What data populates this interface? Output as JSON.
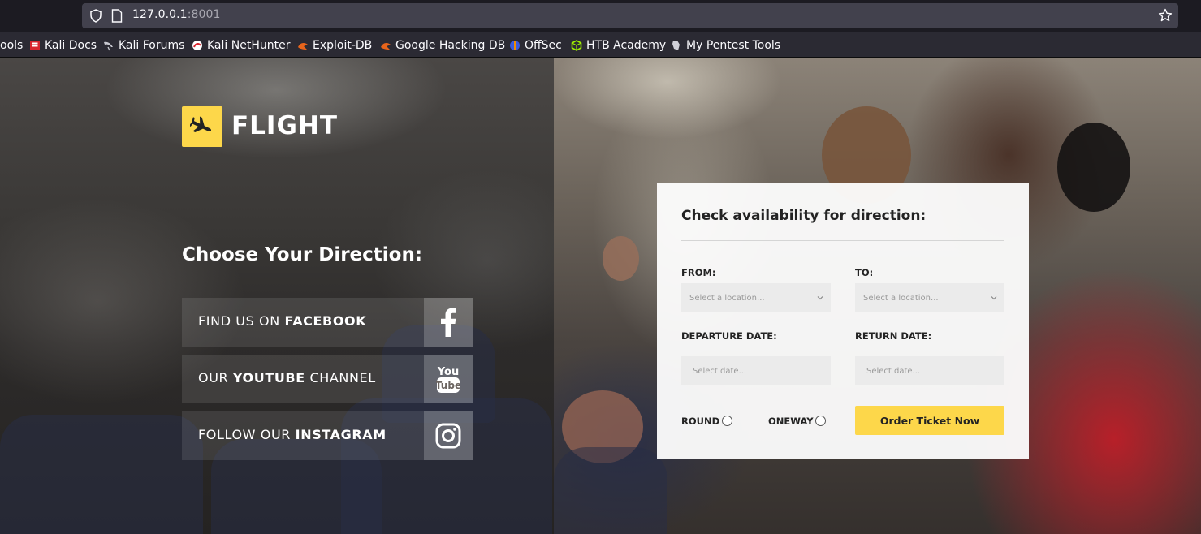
{
  "browser": {
    "url_host": "127.0.0.1",
    "url_port": ":8001",
    "bookmarks": [
      {
        "label": "ools",
        "icon": "none"
      },
      {
        "label": "Kali Docs",
        "icon": "kali-docs-icon"
      },
      {
        "label": "Kali Forums",
        "icon": "kali-dragon-icon"
      },
      {
        "label": "Kali NetHunter",
        "icon": "nethunter-icon"
      },
      {
        "label": "Exploit-DB",
        "icon": "exploit-db-icon"
      },
      {
        "label": "Google Hacking DB",
        "icon": "ghdb-icon"
      },
      {
        "label": "OffSec",
        "icon": "offsec-icon"
      },
      {
        "label": "HTB Academy",
        "icon": "htb-icon"
      },
      {
        "label": "My Pentest Tools",
        "icon": "pentest-tools-icon"
      }
    ]
  },
  "brand": {
    "name": "FLIGHT",
    "accent": "#fdd74a"
  },
  "left": {
    "heading": "Choose Your Direction:",
    "social": [
      {
        "prefix": "FIND US ON ",
        "strong": "FACEBOOK",
        "suffix": "",
        "icon": "facebook-icon"
      },
      {
        "prefix": "OUR ",
        "strong": "YOUTUBE",
        "suffix": " CHANNEL",
        "icon": "youtube-icon"
      },
      {
        "prefix": "FOLLOW OUR ",
        "strong": "INSTAGRAM",
        "suffix": "",
        "icon": "instagram-icon"
      }
    ]
  },
  "form": {
    "title": "Check availability for direction:",
    "from_label": "FROM:",
    "to_label": "TO:",
    "from_placeholder": "Select a location...",
    "to_placeholder": "Select a location...",
    "departure_label": "DEPARTURE DATE:",
    "return_label": "RETURN DATE:",
    "departure_placeholder": "Select date...",
    "return_placeholder": "Select date...",
    "round_label": "ROUND",
    "oneway_label": "ONEWAY",
    "submit_label": "Order Ticket Now"
  }
}
